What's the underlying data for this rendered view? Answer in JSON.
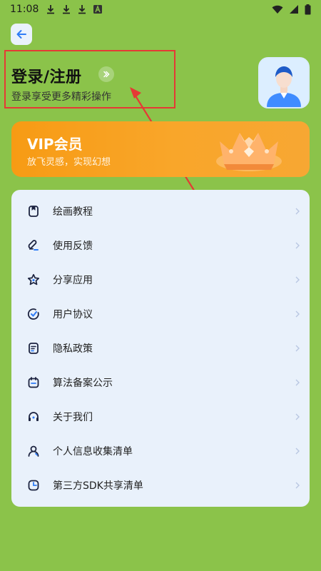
{
  "status_bar": {
    "time": "11:08",
    "left_icons": [
      "download-icon",
      "download-icon",
      "download-icon",
      "app-a-icon"
    ],
    "right_icons": [
      "wifi-icon",
      "signal-icon",
      "battery-icon"
    ]
  },
  "header": {
    "back_icon": "back-arrow-icon"
  },
  "login": {
    "title": "登录/注册",
    "subtitle": "登录享受更多精彩操作"
  },
  "vip": {
    "title": "VIP会员",
    "subtitle": "放飞灵感，实现幻想"
  },
  "menu": {
    "items": [
      {
        "label": "绘画教程",
        "icon": "bookmark-icon"
      },
      {
        "label": "使用反馈",
        "icon": "feedback-icon"
      },
      {
        "label": "分享应用",
        "icon": "star-icon"
      },
      {
        "label": "用户协议",
        "icon": "check-circle-icon"
      },
      {
        "label": "隐私政策",
        "icon": "document-icon"
      },
      {
        "label": "算法备案公示",
        "icon": "calendar-icon"
      },
      {
        "label": "关于我们",
        "icon": "headset-icon"
      },
      {
        "label": "个人信息收集清单",
        "icon": "user-icon"
      },
      {
        "label": "第三方SDK共享清单",
        "icon": "pie-icon"
      }
    ]
  },
  "colors": {
    "background": "#8BC34A",
    "accent_blue": "#2F7CF6",
    "vip_orange": "#F79B14",
    "annotation_red": "#E53935"
  }
}
